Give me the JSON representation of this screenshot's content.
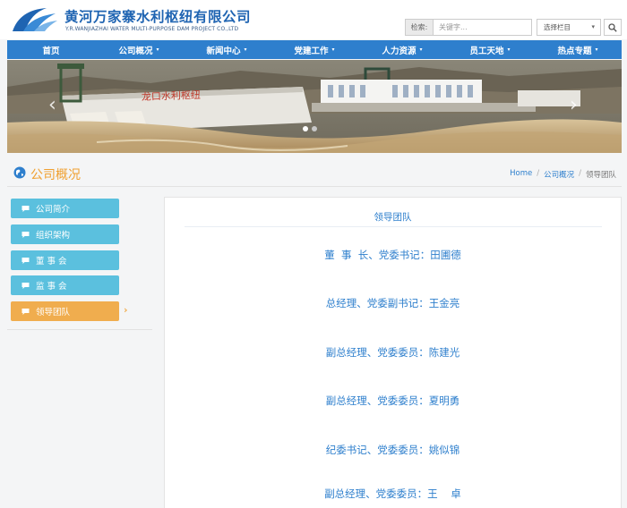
{
  "header": {
    "brand_cn": "黄河万家寨水利枢纽有限公司",
    "brand_en": "Y.R.WANJIAZHAI WATER MULTI-PURPOSE DAM PROJECT CO.,LTD",
    "search_label": "检索:",
    "search_placeholder": "关键字...",
    "select_value": "选择栏目",
    "icons": [
      "logo",
      "search-icon"
    ]
  },
  "nav": {
    "items": [
      "首页",
      "公司概况",
      "新闻中心",
      "党建工作",
      "人力资源",
      "员工天地",
      "热点专题"
    ],
    "dropdown_marker": "▾"
  },
  "banner": {
    "dam_sign": "龙口水利枢纽",
    "prev_arrow": "‹",
    "next_arrow": "›"
  },
  "section": {
    "title": "公司概况",
    "breadcrumb": [
      "Home",
      "公司概况",
      "领导团队"
    ],
    "separator": "/"
  },
  "sidebar": {
    "items": [
      "公司简介",
      "组织架构",
      "董 事 会",
      "监 事 会",
      "领导团队"
    ],
    "active_index": 4,
    "active_marker": "›"
  },
  "content": {
    "title": "领导团队",
    "leaders": [
      "董  事  长、党委书记：田圃德",
      "总经理、党委副书记：王金亮",
      "副总经理、党委委员：陈建光",
      "副总经理、党委委员：夏明勇",
      "纪委书记、党委委员：姚似锦",
      "副总经理、党委委员：王    卓"
    ]
  },
  "colors": {
    "nav_blue": "#2e7fcd",
    "sidebar_cyan": "#5bc0de",
    "sidebar_active": "#f0ad4e",
    "section_orange": "#f0a030",
    "brand_blue": "#1f64b2"
  }
}
